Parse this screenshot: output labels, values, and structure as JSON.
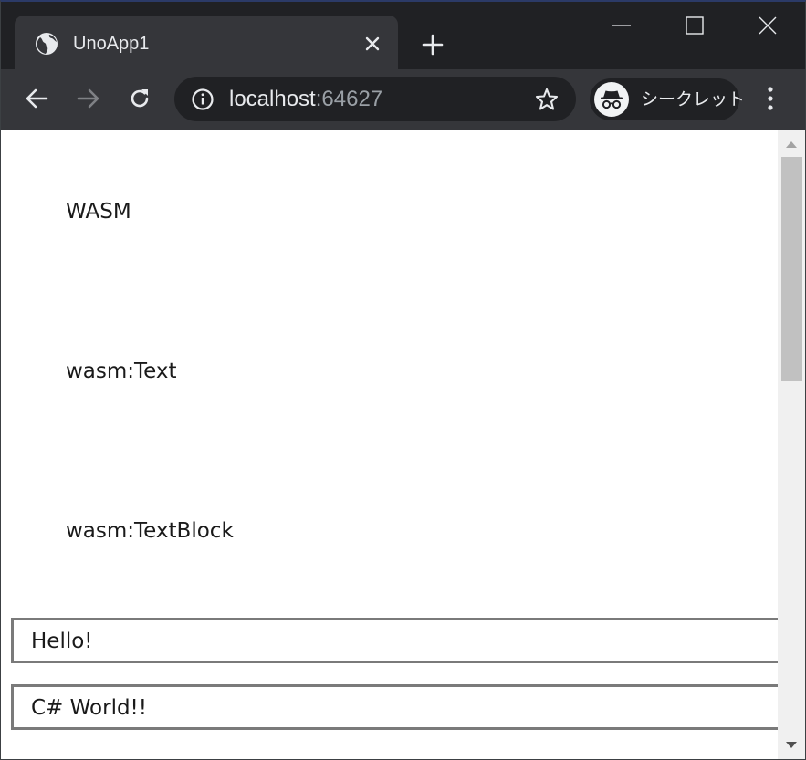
{
  "browser": {
    "tab": {
      "title": "UnoApp1",
      "favicon": "globe-icon"
    },
    "new_tab_icon": "plus-icon",
    "window_controls": [
      "minimize-icon",
      "maximize-icon",
      "close-icon"
    ],
    "address": {
      "host": "localhost",
      "port": ":64627"
    },
    "profile": {
      "label": "シークレット",
      "icon": "incognito-icon"
    },
    "colors": {
      "frame": "#202124",
      "toolbar": "#35363a",
      "text": "#e8eaed",
      "dim_text": "#9aa0a6"
    }
  },
  "page": {
    "items": [
      "WASM",
      "wasm:Text",
      "wasm:TextBlock"
    ],
    "textboxes": [
      "Hello!",
      "C# World!!"
    ]
  }
}
